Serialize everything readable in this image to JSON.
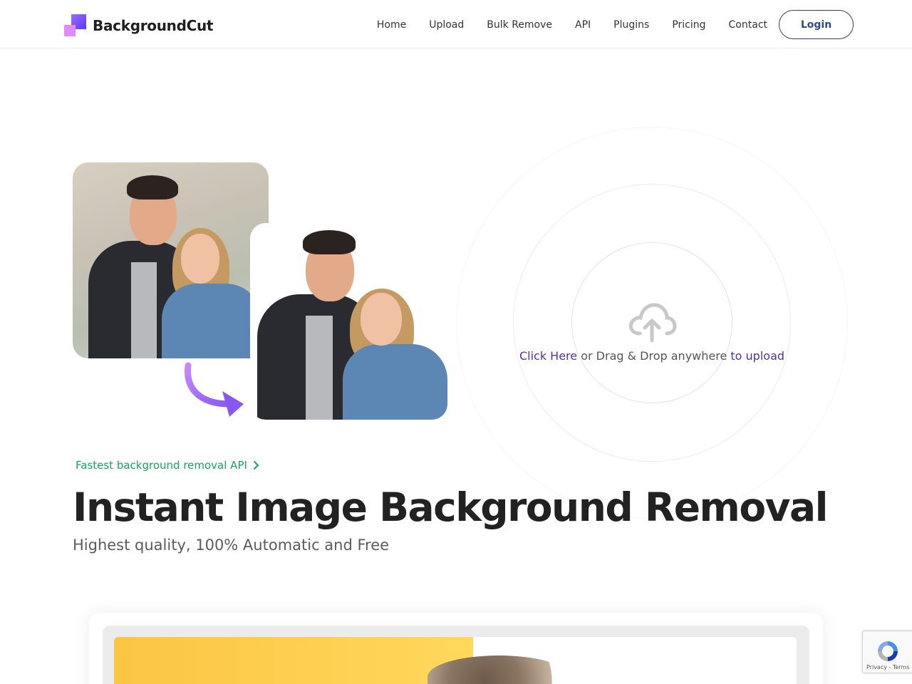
{
  "brand": {
    "name": "BackgroundCut"
  },
  "nav": {
    "items": [
      {
        "id": "home",
        "label": "Home"
      },
      {
        "id": "upload",
        "label": "Upload"
      },
      {
        "id": "bulk-remove",
        "label": "Bulk Remove"
      },
      {
        "id": "api",
        "label": "API"
      },
      {
        "id": "plugins",
        "label": "Plugins"
      },
      {
        "id": "pricing",
        "label": "Pricing"
      },
      {
        "id": "contact",
        "label": "Contact"
      }
    ],
    "login_label": "Login"
  },
  "upload": {
    "click_here": "Click Here",
    "middle": " or Drag & Drop anywhere ",
    "to_upload": "to upload",
    "icon": "cloud-upload-icon"
  },
  "hero": {
    "api_link": "Fastest background removal API",
    "headline": "Instant Image Background Removal",
    "subheadline": "Highest quality, 100% Automatic and Free"
  },
  "recaptcha": {
    "footer": "Privacy - Terms"
  },
  "colors": {
    "accent_purple": "#5b2f9e",
    "api_green": "#18a35f",
    "login_border": "#2e3f78",
    "arrow_gradient_start": "#c38bff",
    "arrow_gradient_end": "#8a56f0"
  }
}
